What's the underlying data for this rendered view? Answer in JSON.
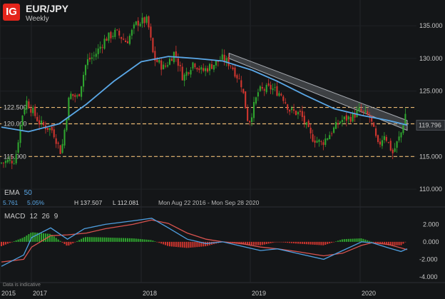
{
  "header": {
    "logo_text": "IG",
    "title": "EUR/JPY",
    "subtitle": "Weekly"
  },
  "ema_panel": {
    "label": "EMA",
    "period": "50",
    "value1": "5.761",
    "value2": "5.05%",
    "high": "H 137.507",
    "low": "L 112.081",
    "range": "Mon Aug 22 2016 - Mon Sep 28 2020"
  },
  "macd_panel": {
    "label": "MACD",
    "p1": "12",
    "p2": "26",
    "p3": "9"
  },
  "footer_note": "Data is indicative",
  "colors": {
    "background": "#141618",
    "bull": "#2fa52f",
    "bear": "#d1362f",
    "ema": "#5aa7e6",
    "level_line": "#e9b872",
    "current_price_box": "#2a2d31",
    "macd_line": "#4f9fe0",
    "signal_line": "#d9534f"
  },
  "chart_data": [
    {
      "type": "candlestick",
      "title": "EUR/JPY",
      "subtitle": "Weekly",
      "y_ticks": [
        "110.000",
        "115.000",
        "120.000",
        "125.000",
        "130.000",
        "135.000"
      ],
      "ylim": [
        107.5,
        138.5
      ],
      "x_labels": [
        "2015",
        "2017",
        "2018",
        "2019",
        "2020"
      ],
      "levels": [
        {
          "value": 122.5,
          "label": "122.500"
        },
        {
          "value": 120.0,
          "label": "120.000"
        },
        {
          "value": 115.0,
          "label": "115.000"
        }
      ],
      "current_price": {
        "value": 119.796,
        "label": "119.796"
      },
      "ema_period": 50,
      "price_path": [
        [
          "2016-08-22",
          114.0
        ],
        [
          "2016-10-31",
          114.5
        ],
        [
          "2016-11-28",
          121.0
        ],
        [
          "2016-12-19",
          123.5
        ],
        [
          "2017-02-06",
          120.0
        ],
        [
          "2017-03-20",
          119.0
        ],
        [
          "2017-04-17",
          115.5
        ],
        [
          "2017-05-15",
          124.5
        ],
        [
          "2017-06-12",
          124.0
        ],
        [
          "2017-07-10",
          129.5
        ],
        [
          "2017-08-07",
          130.5
        ],
        [
          "2017-09-11",
          133.0
        ],
        [
          "2017-10-16",
          134.0
        ],
        [
          "2017-11-20",
          132.5
        ],
        [
          "2017-12-25",
          135.5
        ],
        [
          "2018-01-29",
          135.8
        ],
        [
          "2018-02-19",
          130.0
        ],
        [
          "2018-03-26",
          128.5
        ],
        [
          "2018-04-30",
          131.0
        ],
        [
          "2018-05-28",
          127.0
        ],
        [
          "2018-07-02",
          129.5
        ],
        [
          "2018-07-30",
          128.0
        ],
        [
          "2018-09-03",
          129.0
        ],
        [
          "2018-10-08",
          130.0
        ],
        [
          "2018-11-05",
          129.0
        ],
        [
          "2018-12-10",
          126.0
        ],
        [
          "2019-01-02",
          120.0
        ],
        [
          "2019-02-04",
          125.0
        ],
        [
          "2019-03-18",
          125.5
        ],
        [
          "2019-04-22",
          124.5
        ],
        [
          "2019-05-20",
          122.0
        ],
        [
          "2019-06-24",
          121.5
        ],
        [
          "2019-07-29",
          118.0
        ],
        [
          "2019-09-02",
          117.0
        ],
        [
          "2019-09-30",
          118.5
        ],
        [
          "2019-11-04",
          120.5
        ],
        [
          "2019-12-09",
          121.0
        ],
        [
          "2020-01-06",
          122.0
        ],
        [
          "2020-02-10",
          121.0
        ],
        [
          "2020-03-09",
          116.5
        ],
        [
          "2020-03-30",
          118.5
        ],
        [
          "2020-04-27",
          115.5
        ],
        [
          "2020-05-25",
          118.5
        ],
        [
          "2020-06-08",
          121.5
        ]
      ],
      "ema_path": [
        [
          "2016-08-22",
          119.5
        ],
        [
          "2016-12-19",
          118.8
        ],
        [
          "2017-04-03",
          120.0
        ],
        [
          "2017-07-03",
          123.0
        ],
        [
          "2017-10-02",
          126.5
        ],
        [
          "2018-01-01",
          129.5
        ],
        [
          "2018-04-02",
          130.3
        ],
        [
          "2018-07-02",
          130.0
        ],
        [
          "2018-10-01",
          129.6
        ],
        [
          "2019-01-07",
          128.2
        ],
        [
          "2019-04-01",
          126.5
        ],
        [
          "2019-07-01",
          124.4
        ],
        [
          "2019-10-07",
          122.3
        ],
        [
          "2020-01-06",
          121.3
        ],
        [
          "2020-04-06",
          120.5
        ],
        [
          "2020-06-08",
          119.8
        ]
      ],
      "trendline_upper": [
        [
          "2018-10-22",
          130.8
        ],
        [
          "2020-06-08",
          120.5
        ]
      ],
      "trendline_lower": [
        [
          "2018-10-22",
          130.0
        ],
        [
          "2020-06-08",
          119.0
        ]
      ]
    },
    {
      "type": "macd",
      "title": "MACD",
      "params": [
        12,
        26,
        9
      ],
      "y_ticks": [
        "2.000",
        "0.000",
        "-2.000",
        "-4.000"
      ],
      "ylim": [
        -4.5,
        3.5
      ],
      "macd_path": [
        [
          "2016-08-22",
          -2.8
        ],
        [
          "2016-11-28",
          -1.5
        ],
        [
          "2017-01-02",
          0.5
        ],
        [
          "2017-03-06",
          1.6
        ],
        [
          "2017-05-01",
          0.3
        ],
        [
          "2017-06-26",
          1.5
        ],
        [
          "2017-09-04",
          2.0
        ],
        [
          "2017-12-04",
          2.4
        ],
        [
          "2018-02-05",
          2.7
        ],
        [
          "2018-04-02",
          1.6
        ],
        [
          "2018-06-04",
          0.3
        ],
        [
          "2018-08-06",
          -0.2
        ],
        [
          "2018-10-01",
          0.0
        ],
        [
          "2018-12-03",
          -0.5
        ],
        [
          "2019-02-04",
          -1.0
        ],
        [
          "2019-04-01",
          -0.8
        ],
        [
          "2019-06-03",
          -1.3
        ],
        [
          "2019-09-02",
          -2.0
        ],
        [
          "2019-11-04",
          -1.0
        ],
        [
          "2020-01-06",
          0.0
        ],
        [
          "2020-02-10",
          -0.1
        ],
        [
          "2020-04-06",
          -0.7
        ],
        [
          "2020-05-18",
          -1.1
        ],
        [
          "2020-06-08",
          -0.8
        ]
      ],
      "signal_path": [
        [
          "2016-08-22",
          -2.3
        ],
        [
          "2016-11-28",
          -2.0
        ],
        [
          "2017-01-02",
          -0.6
        ],
        [
          "2017-03-06",
          0.7
        ],
        [
          "2017-05-01",
          0.8
        ],
        [
          "2017-07-03",
          1.0
        ],
        [
          "2017-09-04",
          1.5
        ],
        [
          "2017-12-04",
          2.0
        ],
        [
          "2018-02-05",
          2.5
        ],
        [
          "2018-04-02",
          2.1
        ],
        [
          "2018-06-04",
          1.0
        ],
        [
          "2018-08-06",
          0.3
        ],
        [
          "2018-10-01",
          0.0
        ],
        [
          "2018-12-03",
          -0.2
        ],
        [
          "2019-02-04",
          -0.6
        ],
        [
          "2019-04-01",
          -0.8
        ],
        [
          "2019-06-03",
          -1.1
        ],
        [
          "2019-09-02",
          -1.6
        ],
        [
          "2019-11-04",
          -1.3
        ],
        [
          "2020-01-06",
          -0.4
        ],
        [
          "2020-02-10",
          -0.1
        ],
        [
          "2020-04-06",
          -0.3
        ],
        [
          "2020-05-18",
          -0.7
        ],
        [
          "2020-06-08",
          -0.9
        ]
      ]
    }
  ]
}
